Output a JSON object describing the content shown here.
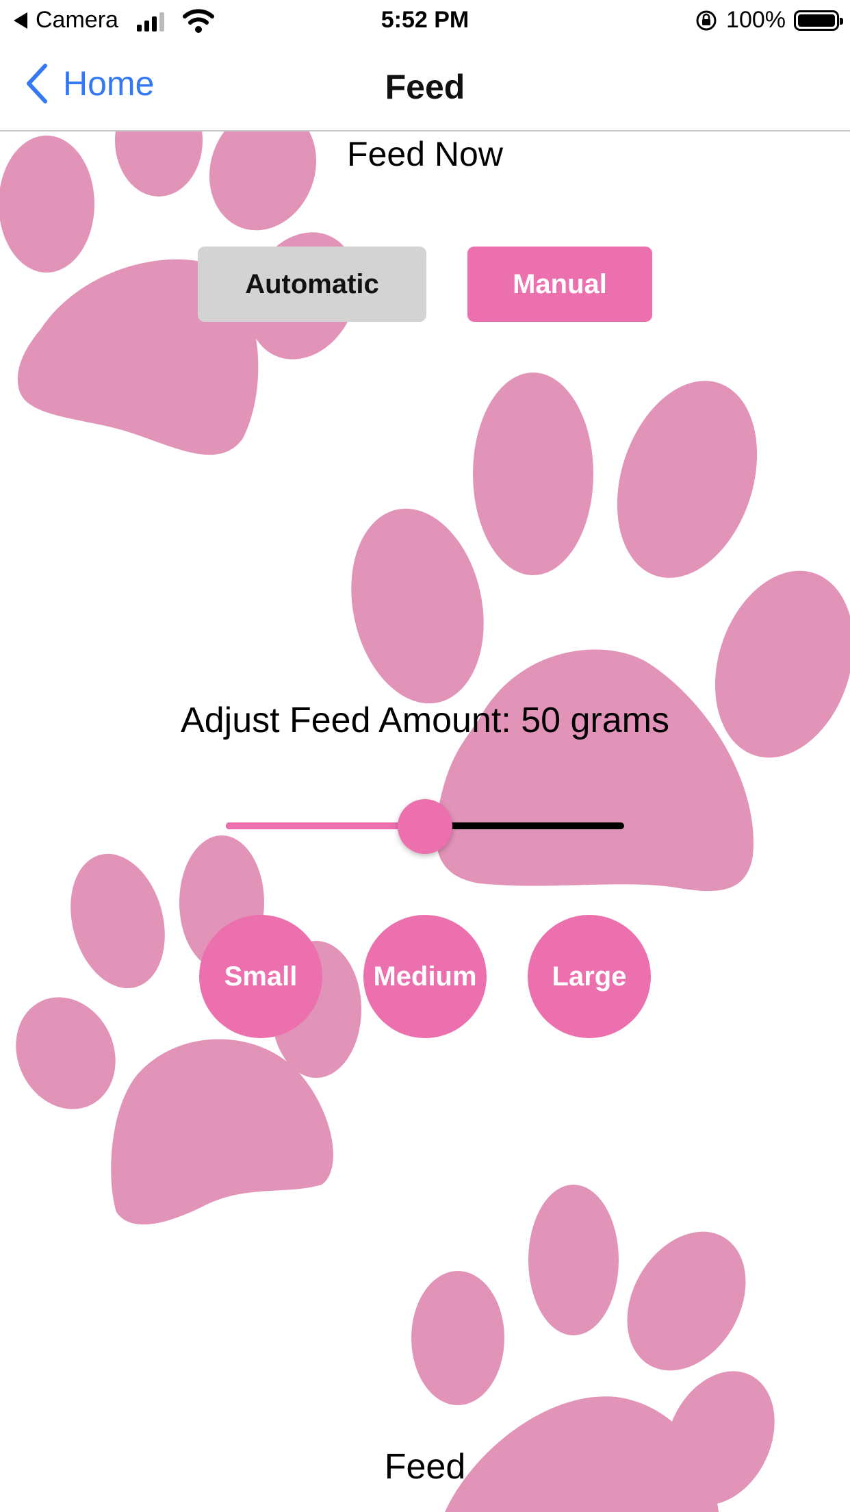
{
  "status_bar": {
    "back_app": "Camera",
    "time": "5:52 PM",
    "battery": "100%",
    "icons": [
      "back-triangle-icon",
      "cellular-signal-icon",
      "wifi-icon",
      "orientation-lock-icon",
      "battery-icon"
    ]
  },
  "nav": {
    "back_label": "Home",
    "title": "Feed",
    "back_icon": "chevron-left-icon"
  },
  "feed_now": {
    "title": "Feed Now"
  },
  "mode": {
    "automatic_label": "Automatic",
    "manual_label": "Manual",
    "selected": "Manual"
  },
  "amount": {
    "label": "Adjust Feed Amount: 50 grams",
    "slider_fraction": 0.5
  },
  "sizes": {
    "small": "Small",
    "medium": "Medium",
    "large": "Large"
  },
  "feed_button": "Feed",
  "colors": {
    "accent": "#ec6fae",
    "paw": "#e293b8",
    "link": "#3478f6",
    "inactive_button": "#d3d3d3"
  },
  "background": "paw-print-pattern"
}
